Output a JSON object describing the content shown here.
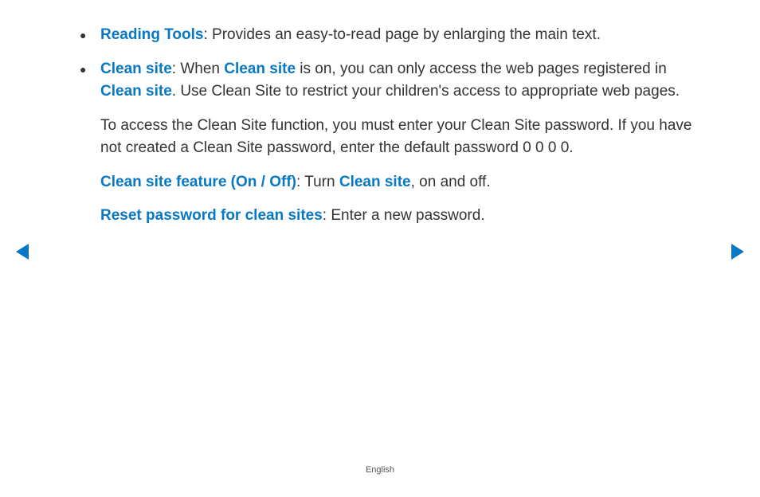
{
  "bullets": [
    {
      "term": "Reading Tools",
      "text": ": Provides an easy-to-read page by enlarging the main text."
    },
    {
      "term": "Clean site",
      "segments": [
        {
          "t": ": When ",
          "h": false
        },
        {
          "t": "Clean site",
          "h": true
        },
        {
          "t": " is on, you can only access the web pages registered in ",
          "h": false
        },
        {
          "t": "Clean site",
          "h": true
        },
        {
          "t": ". Use Clean Site to restrict your children's access to appropriate web pages.",
          "h": false
        }
      ]
    }
  ],
  "para1": "To access the Clean Site function, you must enter your Clean Site password. If you have not created a Clean Site password, enter the default password 0 0 0 0.",
  "para2": {
    "term": "Clean site feature (On / Off)",
    "segments": [
      {
        "t": ": Turn ",
        "h": false
      },
      {
        "t": "Clean site",
        "h": true
      },
      {
        "t": ", on and off.",
        "h": false
      }
    ]
  },
  "para3": {
    "term": "Reset password for clean sites",
    "text": ": Enter a new password."
  },
  "footer": "English"
}
